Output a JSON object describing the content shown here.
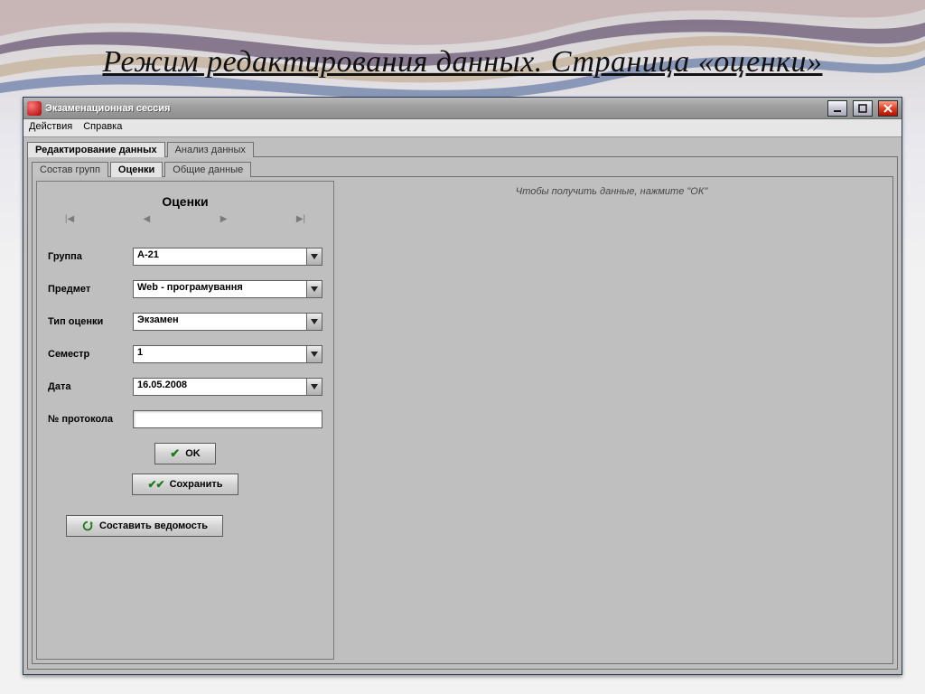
{
  "slide": {
    "title": "Режим редактирования данных. Страница «оценки»"
  },
  "window": {
    "title": "Экзаменационная сессия",
    "menus": {
      "actions": "Действия",
      "help": "Справка"
    },
    "tabs_top": {
      "edit": "Редактирование данных",
      "analyze": "Анализ данных"
    },
    "tabs_inner": {
      "groups": "Состав групп",
      "grades": "Оценки",
      "common": "Общие данные"
    },
    "panel_title": "Оценки",
    "hint": "Чтобы получить данные, нажмите \"ОК\"",
    "labels": {
      "group": "Группа",
      "subject": "Предмет",
      "grade_type": "Тип оценки",
      "semester": "Семестр",
      "date": "Дата",
      "protocol": "№ протокола"
    },
    "values": {
      "group": "А-21",
      "subject": "Web - програмування",
      "grade_type": "Экзамен",
      "semester": "1",
      "date": "16.05.2008",
      "protocol": ""
    },
    "buttons": {
      "ok": "OK",
      "save": "Сохранить",
      "build_list": "Составить ведомость"
    }
  }
}
